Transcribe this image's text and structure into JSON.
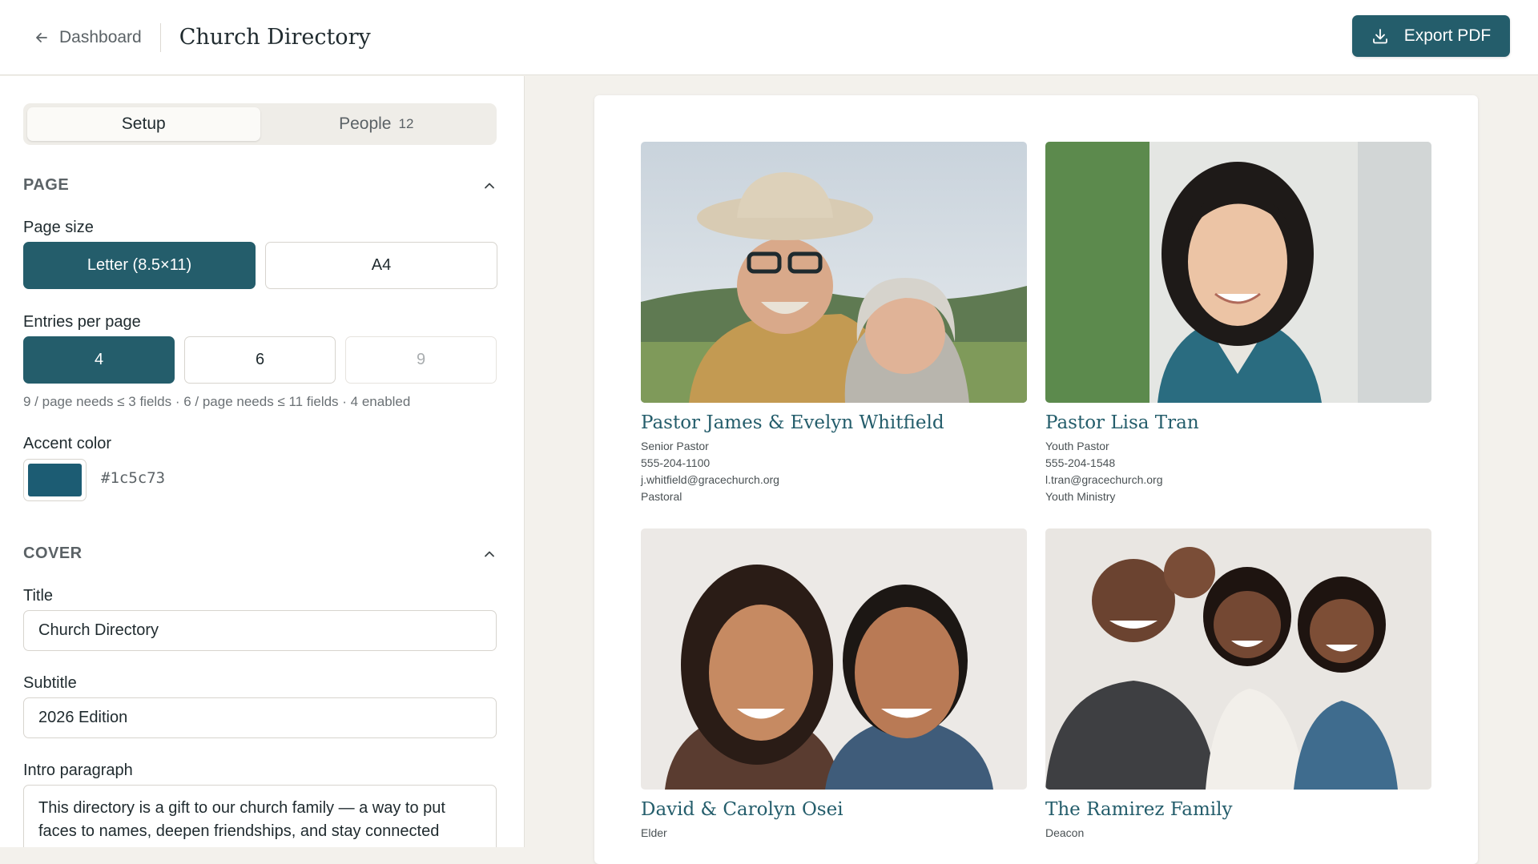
{
  "header": {
    "back_label": "Dashboard",
    "app_title": "Church Directory",
    "export_label": "Export PDF"
  },
  "tabs": {
    "setup_label": "Setup",
    "people_label": "People",
    "people_count": "12"
  },
  "page_section": {
    "heading": "PAGE",
    "page_size_label": "Page size",
    "page_size_options": [
      "Letter (8.5×11)",
      "A4"
    ],
    "page_size_selected": "Letter (8.5×11)",
    "entries_label": "Entries per page",
    "entries_options": [
      "4",
      "6",
      "9"
    ],
    "entries_selected": "4",
    "entries_hint": "9 / page needs ≤ 3 fields · 6 / page needs ≤ 11 fields · 4 enabled",
    "accent_label": "Accent color",
    "accent_hex": "#1c5c73"
  },
  "cover_section": {
    "heading": "COVER",
    "title_label": "Title",
    "title_value": "Church Directory",
    "subtitle_label": "Subtitle",
    "subtitle_value": "2026 Edition",
    "intro_label": "Intro paragraph",
    "intro_value": "This directory is a gift to our church family — a way to put faces to names, deepen friendships, and stay connected"
  },
  "directory": {
    "entries": [
      {
        "name": "Pastor James & Evelyn Whitfield",
        "role": "Senior Pastor",
        "phone": "555-204-1100",
        "email": "j.whitfield@gracechurch.org",
        "ministry": "Pastoral"
      },
      {
        "name": "Pastor Lisa Tran",
        "role": "Youth Pastor",
        "phone": "555-204-1548",
        "email": "l.tran@gracechurch.org",
        "ministry": "Youth Ministry"
      },
      {
        "name": "David & Carolyn Osei",
        "role": "Elder"
      },
      {
        "name": "The Ramirez Family",
        "role": "Deacon"
      }
    ]
  },
  "colors": {
    "primary": "#245d6b",
    "accent": "#1c5c73"
  }
}
